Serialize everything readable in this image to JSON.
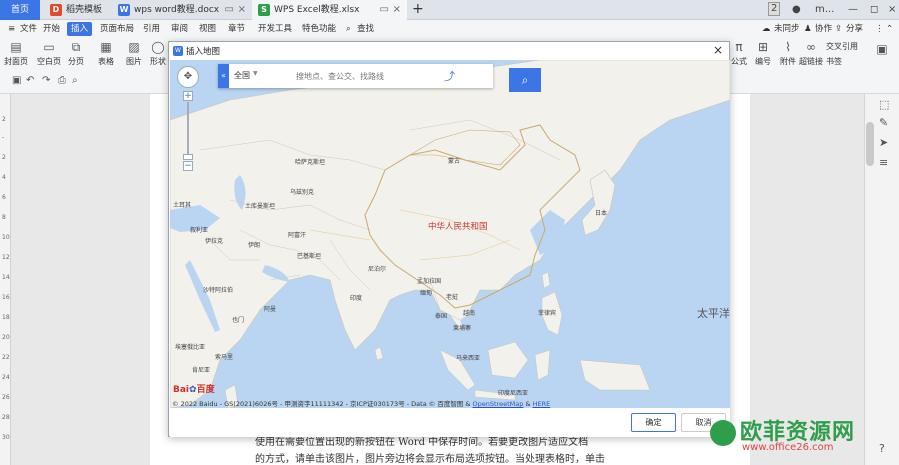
{
  "tabs": {
    "home": "首页",
    "items": [
      {
        "label": "稻壳模板",
        "icon": "D",
        "icon_color": "#e5462e"
      },
      {
        "label": "wps word教程.docx",
        "icon": "W",
        "icon_color": "#3b75e6"
      },
      {
        "label": "WPS Excel教程.xlsx",
        "icon": "S",
        "icon_color": "#2f9e4a"
      }
    ],
    "add": "+",
    "badge": "2",
    "user": "m..."
  },
  "menu": {
    "file": "文件",
    "items": [
      "开始",
      "插入",
      "页面布局",
      "引用",
      "审阅",
      "视图",
      "章节",
      "开发工具",
      "特色功能"
    ],
    "search": "查找",
    "sync": "未同步",
    "collab": "协作",
    "share": "分享"
  },
  "toolbar": {
    "left": [
      "封面页",
      "空白页",
      "分页",
      "表格",
      "图片",
      "形状"
    ],
    "right": [
      "公式",
      "编号",
      "附件",
      "超链接",
      "书签"
    ],
    "crossref": "交叉引用"
  },
  "dialog": {
    "title": "插入地图",
    "search": {
      "region": "全国",
      "placeholder": "搜地点、查公交、找路线"
    },
    "map_labels": {
      "kazakhstan": "哈萨克斯坦",
      "mongolia": "蒙古",
      "uzbekistan": "乌兹别克",
      "turkmenistan": "土库曼斯坦",
      "afghanistan": "阿富汗",
      "pakistan": "巴基斯坦",
      "iran": "伊朗",
      "iraq": "伊拉克",
      "turkey": "土耳其",
      "syria": "叙利亚",
      "saudi": "沙特阿拉伯",
      "oman": "阿曼",
      "yemen": "也门",
      "ethiopia": "埃塞俄比亚",
      "somalia": "索马里",
      "kenya": "肯尼亚",
      "india": "印度",
      "nepal": "尼泊尔",
      "bangladesh": "孟加拉国",
      "myanmar": "缅甸",
      "thailand": "泰国",
      "laos": "老挝",
      "cambodia": "柬埔寨",
      "vietnam": "越南",
      "philippines": "菲律宾",
      "malaysia": "马来西亚",
      "indonesia": "印度尼西亚",
      "japan": "日本",
      "china": "中华人民共和国",
      "pacific": "太平洋"
    },
    "copyright": "© 2022 Baidu - GS(2021)6026号 - 甲测资字11111342 - 京ICP证030173号 - Data © 百度智图 & ",
    "osm": "OpenStreetMap",
    "here": "HERE",
    "baidu_logo": "Bai",
    "baidu_logo_cn": "百度",
    "ok": "确定",
    "cancel": "取消"
  },
  "document": {
    "line1": "使用在需要位置出现的新按钮在 Word 中保存时间。若要更改图片适应文档",
    "line2": "的方式，请单击该图片，图片旁边将会显示布局选项按钮。当处理表格时，单击"
  },
  "watermark": {
    "title": "欧菲资源网",
    "sub": "www.office26.com"
  }
}
